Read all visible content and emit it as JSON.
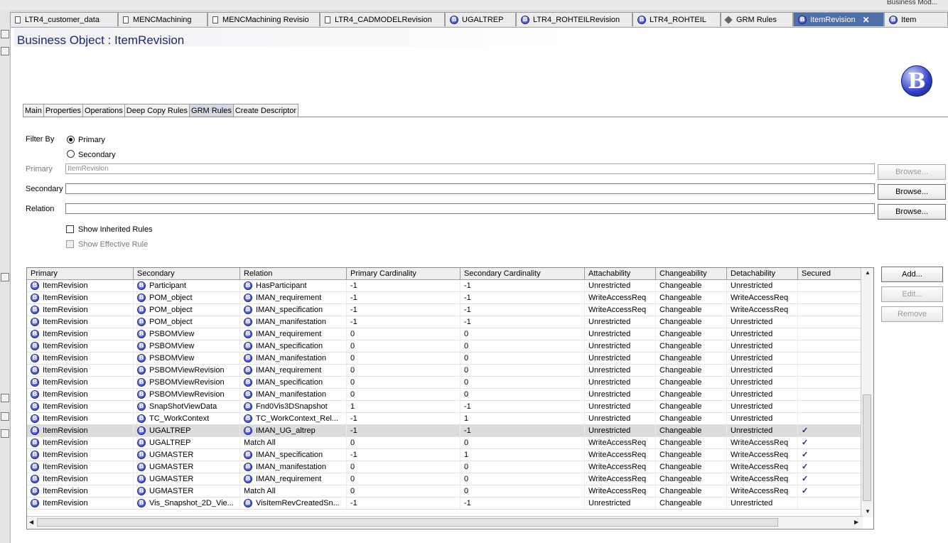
{
  "top_strip": {
    "right_label": "Business Mod..."
  },
  "editor_tabs": [
    {
      "label": "LTR4_customer_data",
      "icon": "doc-icon",
      "active": false
    },
    {
      "label": "MENCMachining",
      "icon": "doc-icon",
      "active": false
    },
    {
      "label": "MENCMachining Revisio",
      "icon": "doc-icon",
      "active": false
    },
    {
      "label": "LTR4_CADMODELRevision",
      "icon": "doc-icon",
      "active": false
    },
    {
      "label": "UGALTREP",
      "icon": "business-object-icon",
      "active": false
    },
    {
      "label": "LTR4_ROHTEILRevision",
      "icon": "business-object-icon",
      "active": false
    },
    {
      "label": "LTR4_ROHTEIL",
      "icon": "business-object-icon",
      "active": false
    },
    {
      "label": "GRM Rules",
      "icon": "grm-rules-icon",
      "active": false
    },
    {
      "label": "ItemRevision",
      "icon": "business-object-icon",
      "active": true,
      "close": "✕"
    },
    {
      "label": "Item",
      "icon": "business-object-icon",
      "active": false
    }
  ],
  "page": {
    "title": "Business Object : ItemRevision",
    "subtabs": [
      "Main",
      "Properties",
      "Operations",
      "Deep Copy Rules",
      "GRM Rules",
      "Create Descriptor"
    ],
    "active_subtab": "GRM Rules"
  },
  "filter": {
    "label": "Filter By",
    "options": [
      "Primary",
      "Secondary"
    ],
    "selected": "Primary",
    "primary_label": "Primary",
    "primary_value": "ItemRevision",
    "secondary_label": "Secondary",
    "secondary_value": "",
    "relation_label": "Relation",
    "relation_value": "",
    "browse_label": "Browse...",
    "show_inherited_label": "Show Inherited Rules",
    "show_effective_label": "Show Effective Rule"
  },
  "actions": {
    "add": "Add...",
    "edit": "Edit...",
    "remove": "Remove"
  },
  "table": {
    "columns": [
      "Primary",
      "Secondary",
      "Relation",
      "Primary Cardinality",
      "Secondary Cardinality",
      "Attachability",
      "Changeability",
      "Detachability",
      "Secured"
    ],
    "rows": [
      [
        "ItemRevision",
        "Participant",
        "HasParticipant",
        "-1",
        "-1",
        "Unrestricted",
        "Changeable",
        "Unrestricted",
        ""
      ],
      [
        "ItemRevision",
        "POM_object",
        "IMAN_requirement",
        "-1",
        "-1",
        "WriteAccessReq",
        "Changeable",
        "WriteAccessReq",
        ""
      ],
      [
        "ItemRevision",
        "POM_object",
        "IMAN_specification",
        "-1",
        "-1",
        "WriteAccessReq",
        "Changeable",
        "WriteAccessReq",
        ""
      ],
      [
        "ItemRevision",
        "POM_object",
        "IMAN_manifestation",
        "-1",
        "-1",
        "Unrestricted",
        "Changeable",
        "Unrestricted",
        ""
      ],
      [
        "ItemRevision",
        "PSBOMView",
        "IMAN_requirement",
        "0",
        "0",
        "Unrestricted",
        "Changeable",
        "Unrestricted",
        ""
      ],
      [
        "ItemRevision",
        "PSBOMView",
        "IMAN_specification",
        "0",
        "0",
        "Unrestricted",
        "Changeable",
        "Unrestricted",
        ""
      ],
      [
        "ItemRevision",
        "PSBOMView",
        "IMAN_manifestation",
        "0",
        "0",
        "Unrestricted",
        "Changeable",
        "Unrestricted",
        ""
      ],
      [
        "ItemRevision",
        "PSBOMViewRevision",
        "IMAN_requirement",
        "0",
        "0",
        "Unrestricted",
        "Changeable",
        "Unrestricted",
        ""
      ],
      [
        "ItemRevision",
        "PSBOMViewRevision",
        "IMAN_specification",
        "0",
        "0",
        "Unrestricted",
        "Changeable",
        "Unrestricted",
        ""
      ],
      [
        "ItemRevision",
        "PSBOMViewRevision",
        "IMAN_manifestation",
        "0",
        "0",
        "Unrestricted",
        "Changeable",
        "Unrestricted",
        ""
      ],
      [
        "ItemRevision",
        "SnapShotViewData",
        "Fnd0Vis3DSnapshot",
        "1",
        "-1",
        "Unrestricted",
        "Changeable",
        "Unrestricted",
        ""
      ],
      [
        "ItemRevision",
        "TC_WorkContext",
        "TC_WorkContext_Rel...",
        "-1",
        "1",
        "Unrestricted",
        "Changeable",
        "Unrestricted",
        ""
      ],
      [
        "ItemRevision",
        "UGALTREP",
        "IMAN_UG_altrep",
        "-1",
        "-1",
        "Unrestricted",
        "Changeable",
        "Unrestricted",
        "✓"
      ],
      [
        "ItemRevision",
        "UGALTREP",
        "Match All",
        "0",
        "0",
        "WriteAccessReq",
        "Changeable",
        "WriteAccessReq",
        "✓"
      ],
      [
        "ItemRevision",
        "UGMASTER",
        "IMAN_specification",
        "-1",
        "1",
        "WriteAccessReq",
        "Changeable",
        "WriteAccessReq",
        "✓"
      ],
      [
        "ItemRevision",
        "UGMASTER",
        "IMAN_manifestation",
        "0",
        "0",
        "WriteAccessReq",
        "Changeable",
        "WriteAccessReq",
        "✓"
      ],
      [
        "ItemRevision",
        "UGMASTER",
        "IMAN_requirement",
        "0",
        "0",
        "WriteAccessReq",
        "Changeable",
        "WriteAccessReq",
        "✓"
      ],
      [
        "ItemRevision",
        "UGMASTER",
        "Match All",
        "0",
        "0",
        "WriteAccessReq",
        "Changeable",
        "WriteAccessReq",
        "✓"
      ],
      [
        "ItemRevision",
        "Vis_Snapshot_2D_Vie...",
        "VisItemRevCreatedSn...",
        "-1",
        "-1",
        "Unrestricted",
        "Changeable",
        "Unrestricted",
        ""
      ]
    ],
    "selected_row": 12
  }
}
